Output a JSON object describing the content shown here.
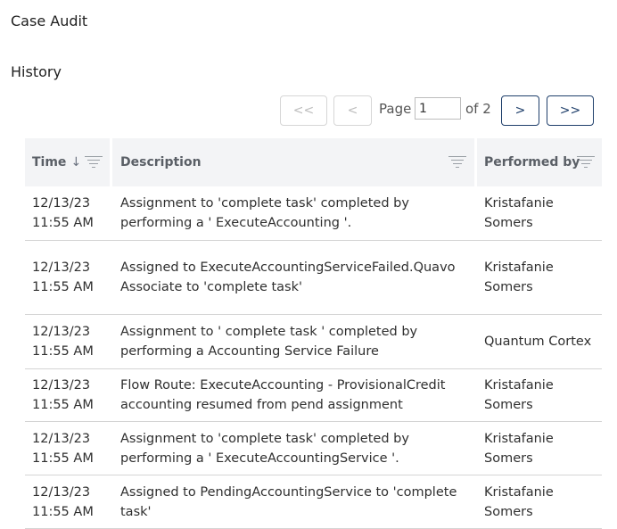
{
  "page": {
    "title": "Case Audit",
    "section": "History"
  },
  "pager": {
    "first": "<<",
    "prev": "<",
    "next": ">",
    "last": ">>",
    "page_label": "Page",
    "page_value": "1",
    "of_label": "of 2"
  },
  "table": {
    "headers": {
      "time": "Time",
      "description": "Description",
      "performed_by": "Performed by"
    },
    "sort_icon": "↓",
    "rows": [
      {
        "date": "12/13/23",
        "time": "11:55 AM",
        "description": "Assignment to 'complete task' completed by performing a ' ExecuteAccounting '.",
        "performer": "Kristafanie Somers"
      },
      {
        "date": "12/13/23",
        "time": "11:55 AM",
        "description": "Assigned to ExecuteAccountingServiceFailed.QuavoAssociate to 'complete task'",
        "performer": "Kristafanie Somers"
      },
      {
        "date": "12/13/23",
        "time": "11:55 AM",
        "description": "Assignment to ' complete task ' completed by performing a Accounting Service Failure",
        "performer": "Quantum Cortex"
      },
      {
        "date": "12/13/23",
        "time": "11:55 AM",
        "description": "Flow Route: ExecuteAccounting - ProvisionalCredit accounting resumed from pend assignment",
        "performer": "Kristafanie Somers"
      },
      {
        "date": "12/13/23",
        "time": "11:55 AM",
        "description": "Assignment to 'complete task' completed by performing a ' ExecuteAccountingService '.",
        "performer": "Kristafanie Somers"
      },
      {
        "date": "12/13/23",
        "time": "11:55 AM",
        "description": "Assigned to PendingAccountingService to 'complete task'",
        "performer": "Kristafanie Somers"
      }
    ]
  }
}
